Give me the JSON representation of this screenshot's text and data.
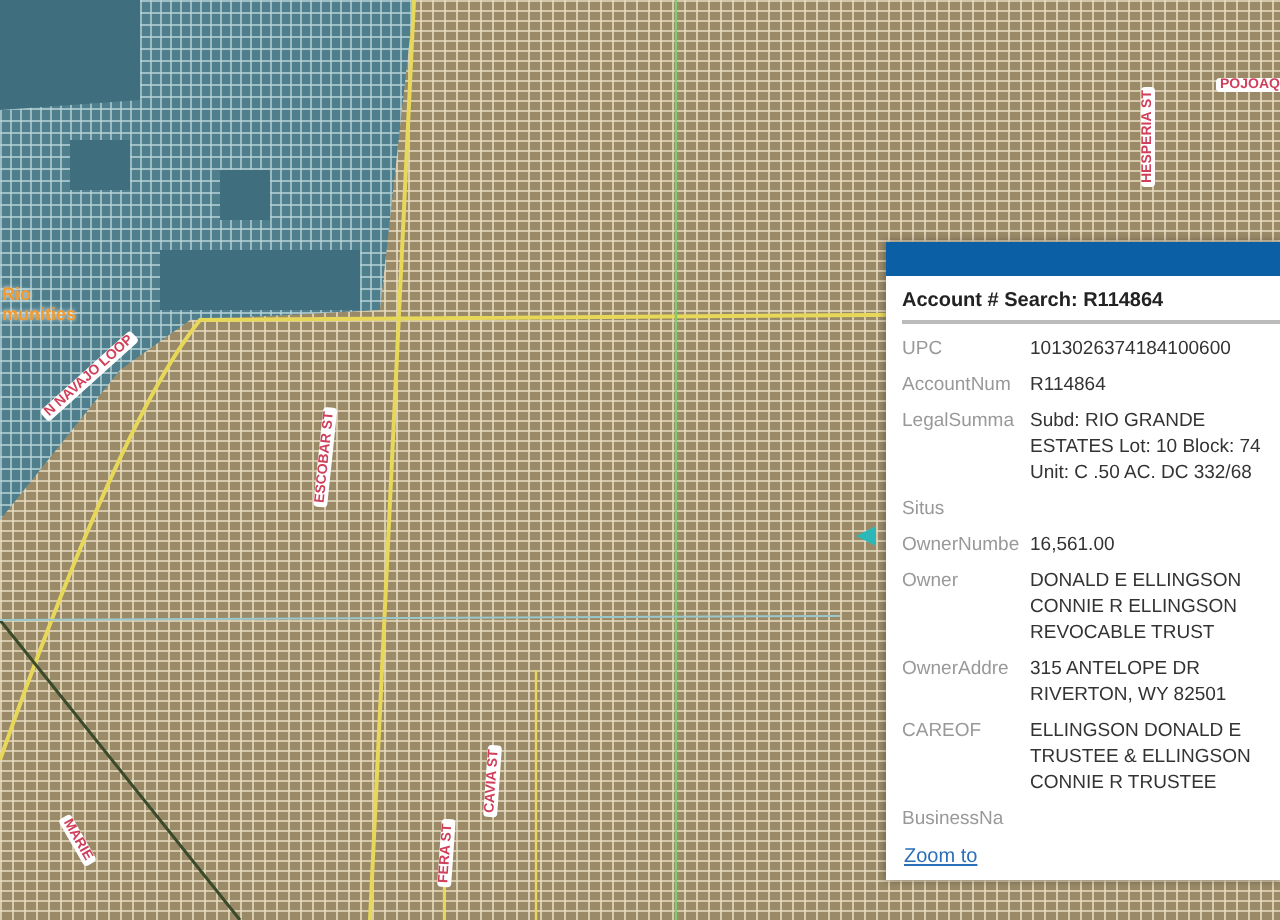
{
  "map": {
    "area_labels": [
      {
        "text": "Rio",
        "kind": "area"
      },
      {
        "text": "munities",
        "kind": "area"
      }
    ],
    "street_labels": [
      {
        "text": "N NAVAJO LOOP",
        "kind": "street"
      },
      {
        "text": "ESCOBAR ST",
        "kind": "street"
      },
      {
        "text": "HESPERIA ST",
        "kind": "street"
      },
      {
        "text": "POJOAQ",
        "kind": "street"
      },
      {
        "text": "MARIE",
        "kind": "street"
      },
      {
        "text": "CAVIA ST",
        "kind": "street"
      },
      {
        "text": "FERA ST",
        "kind": "street"
      }
    ]
  },
  "popup": {
    "title": "Account # Search: R114864",
    "fields": [
      {
        "label": "UPC",
        "lines": [
          "1013026374184100600"
        ]
      },
      {
        "label": "AccountNum",
        "lines": [
          "R114864"
        ]
      },
      {
        "label": "LegalSumma",
        "lines": [
          "Subd: RIO GRANDE",
          "ESTATES Lot: 10 Block: 74",
          "Unit: C .50 AC. DC 332/68"
        ]
      },
      {
        "label": "Situs"
      },
      {
        "label": "OwnerNumbe",
        "lines": [
          "16,561.00"
        ]
      },
      {
        "label": "Owner",
        "lines": [
          "DONALD E ELLINGSON",
          "CONNIE R ELLINGSON",
          "REVOCABLE TRUST"
        ]
      },
      {
        "label": "OwnerAddre",
        "lines": [
          "315 ANTELOPE DR",
          "RIVERTON, WY 82501"
        ]
      },
      {
        "label": "CAREOF",
        "lines": [
          "ELLINGSON DONALD E",
          "TRUSTEE & ELLINGSON",
          "CONNIE R TRUSTEE"
        ]
      },
      {
        "label": "BusinessNa"
      }
    ],
    "link": "Zoom to"
  }
}
